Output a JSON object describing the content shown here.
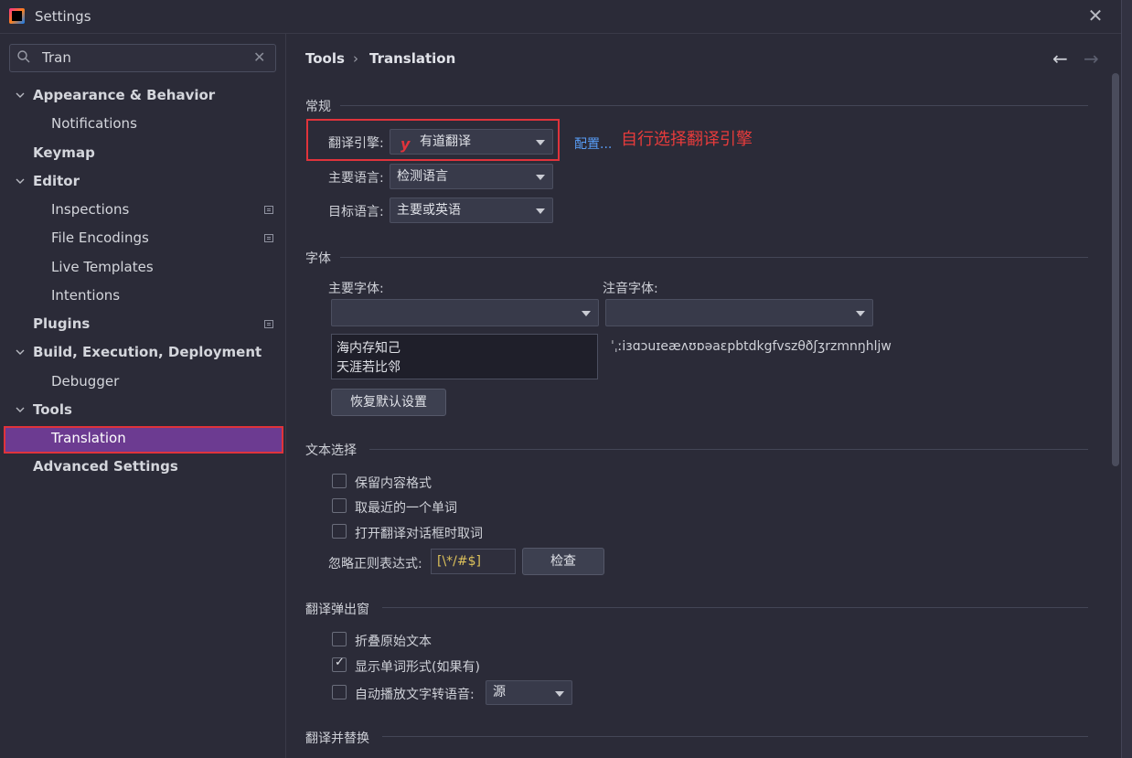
{
  "window": {
    "title": "Settings"
  },
  "search": {
    "value": "Tran"
  },
  "sidebar": {
    "items": [
      {
        "label": "Appearance & Behavior"
      },
      {
        "label": "Notifications"
      },
      {
        "label": "Keymap"
      },
      {
        "label": "Editor"
      },
      {
        "label": "Inspections"
      },
      {
        "label": "File Encodings"
      },
      {
        "label": "Live Templates"
      },
      {
        "label": "Intentions"
      },
      {
        "label": "Plugins"
      },
      {
        "label": "Build, Execution, Deployment"
      },
      {
        "label": "Debugger"
      },
      {
        "label": "Tools"
      },
      {
        "label": "Translation"
      },
      {
        "label": "Advanced Settings"
      }
    ]
  },
  "breadcrumb": {
    "parent": "Tools",
    "separator": "›",
    "current": "Translation"
  },
  "general": {
    "title": "常规",
    "engine_label": "翻译引擎:",
    "engine_value": "有道翻译",
    "config_link": "配置...",
    "annotation": "自行选择翻译引擎",
    "primary_lang_label": "主要语言:",
    "primary_lang_value": "检测语言",
    "target_lang_label": "目标语言:",
    "target_lang_value": "主要或英语"
  },
  "fonts": {
    "title": "字体",
    "primary_font_label": "主要字体:",
    "phonetic_font_label": "注音字体:",
    "preview_line1": "海内存知己",
    "preview_line2": "天涯若比邻",
    "phonetic_preview": "ˈˌːiɜɑɔuɪeæʌʊɒəaɛpbtdkgfvszθðʃʒrzmnŋhljw",
    "reset_button": "恢复默认设置"
  },
  "text_selection": {
    "title": "文本选择",
    "keep_format": "保留内容格式",
    "nearest_word": "取最近的一个单词",
    "pick_on_open": "打开翻译对话框时取词",
    "ignore_regex_label": "忽略正则表达式:",
    "ignore_regex_value": "[\\*/#$]",
    "check_button": "检查"
  },
  "popup": {
    "title": "翻译弹出窗",
    "fold_original": "折叠原始文本",
    "show_word_forms": "显示单词形式(如果有)",
    "auto_tts": "自动播放文字转语音:",
    "tts_value": "源"
  },
  "replace": {
    "title": "翻译并替换"
  }
}
